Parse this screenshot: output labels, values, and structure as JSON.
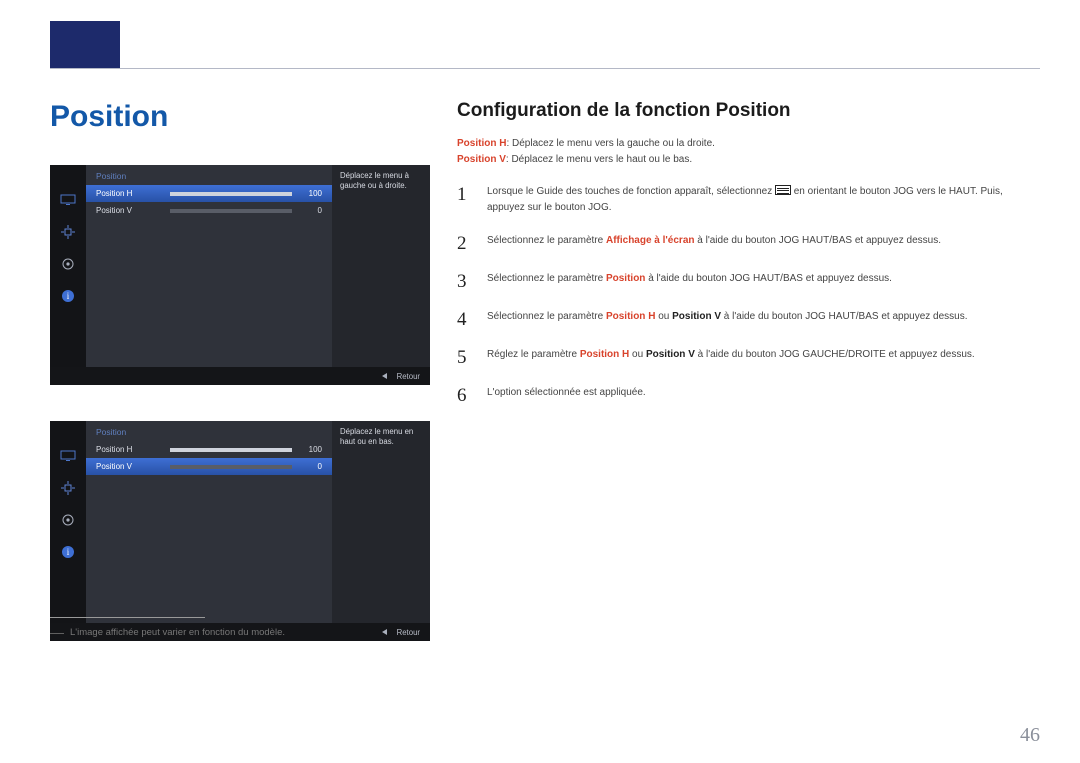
{
  "page_number": "46",
  "sidebar_title": "Position",
  "footnote": "L'image affichée peut varier en fonction du modèle.",
  "content": {
    "heading": "Configuration de la fonction Position",
    "def_h_key": "Position H",
    "def_h_txt": ": Déplacez le menu vers la gauche ou la droite.",
    "def_v_key": "Position V",
    "def_v_txt": ": Déplacez le menu vers le haut ou le bas.",
    "step1_a": "Lorsque le Guide des touches de fonction apparaît, sélectionnez ",
    "step1_b": " en orientant le bouton JOG vers le HAUT. Puis, appuyez sur le bouton JOG.",
    "step2_a": "Sélectionnez le paramètre ",
    "step2_hl": "Affichage à l'écran",
    "step2_b": " à l'aide du bouton JOG HAUT/BAS et appuyez dessus.",
    "step3_a": "Sélectionnez le paramètre ",
    "step3_hl": "Position",
    "step3_b": " à l'aide du bouton JOG HAUT/BAS et appuyez dessus.",
    "step4_a": "Sélectionnez le paramètre ",
    "step4_hl1": "Position H",
    "step4_mid": " ou ",
    "step4_hl2": "Position V",
    "step4_b": " à l'aide du bouton JOG HAUT/BAS et appuyez dessus.",
    "step5_a": "Réglez le paramètre ",
    "step5_hl1": "Position H",
    "step5_mid": " ou ",
    "step5_hl2": "Position V",
    "step5_b": " à l'aide du bouton JOG GAUCHE/DROITE et appuyez dessus.",
    "step6": "L'option sélectionnée est appliquée."
  },
  "osd": {
    "title": "Position",
    "row_h": "Position H",
    "row_v": "Position V",
    "val_h": "100",
    "val_v": "0",
    "return": "Retour",
    "desc1": "Déplacez le menu à gauche ou à droite.",
    "desc2": "Déplacez le menu en haut ou en bas."
  },
  "chart_data": {
    "type": "bar",
    "title": "Position OSD sliders",
    "series": [
      {
        "name": "Position H",
        "value": 100,
        "range": [
          0,
          100
        ]
      },
      {
        "name": "Position V",
        "value": 0,
        "range": [
          0,
          100
        ]
      }
    ]
  }
}
